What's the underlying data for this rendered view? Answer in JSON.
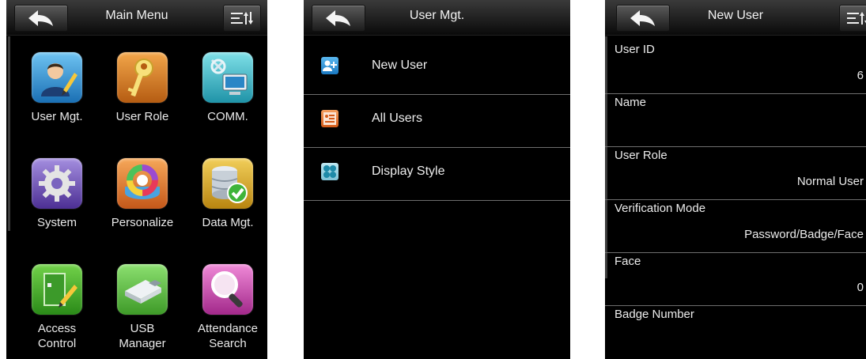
{
  "main_menu": {
    "title": "Main Menu",
    "items": [
      {
        "label_lines": [
          "User Mgt."
        ],
        "icon": "user-mgt-icon"
      },
      {
        "label_lines": [
          "User Role"
        ],
        "icon": "key-icon"
      },
      {
        "label_lines": [
          "COMM."
        ],
        "icon": "network-computer-icon"
      },
      {
        "label_lines": [
          "System"
        ],
        "icon": "gear-icon"
      },
      {
        "label_lines": [
          "Personalize"
        ],
        "icon": "color-wheel-icon"
      },
      {
        "label_lines": [
          "Data Mgt."
        ],
        "icon": "database-check-icon"
      },
      {
        "label_lines": [
          "Access",
          "Control"
        ],
        "icon": "door-pen-icon"
      },
      {
        "label_lines": [
          "USB",
          "Manager"
        ],
        "icon": "usb-drive-icon"
      },
      {
        "label_lines": [
          "Attendance",
          "Search"
        ],
        "icon": "magnifier-icon"
      }
    ]
  },
  "user_mgt": {
    "title": "User Mgt.",
    "items": [
      {
        "label": "New User",
        "icon": "add-user-icon",
        "color": "#2b8fd6"
      },
      {
        "label": "All Users",
        "icon": "user-list-icon",
        "color": "#e8762a"
      },
      {
        "label": "Display Style",
        "icon": "display-style-icon",
        "color": "#2fa6c4"
      }
    ]
  },
  "new_user": {
    "title": "New User",
    "fields": [
      {
        "label": "User ID",
        "value": "6"
      },
      {
        "label": "Name",
        "value": ""
      },
      {
        "label": "User Role",
        "value": "Normal User"
      },
      {
        "label": "Verification Mode",
        "value": "Password/Badge/Face"
      },
      {
        "label": "Face",
        "value": "0"
      },
      {
        "label": "Badge Number",
        "value": ""
      }
    ]
  },
  "colors": {
    "background": "#000000",
    "header_top": "#3a3a3a",
    "divider": "#6e6e6e",
    "text": "#eeeeee"
  }
}
